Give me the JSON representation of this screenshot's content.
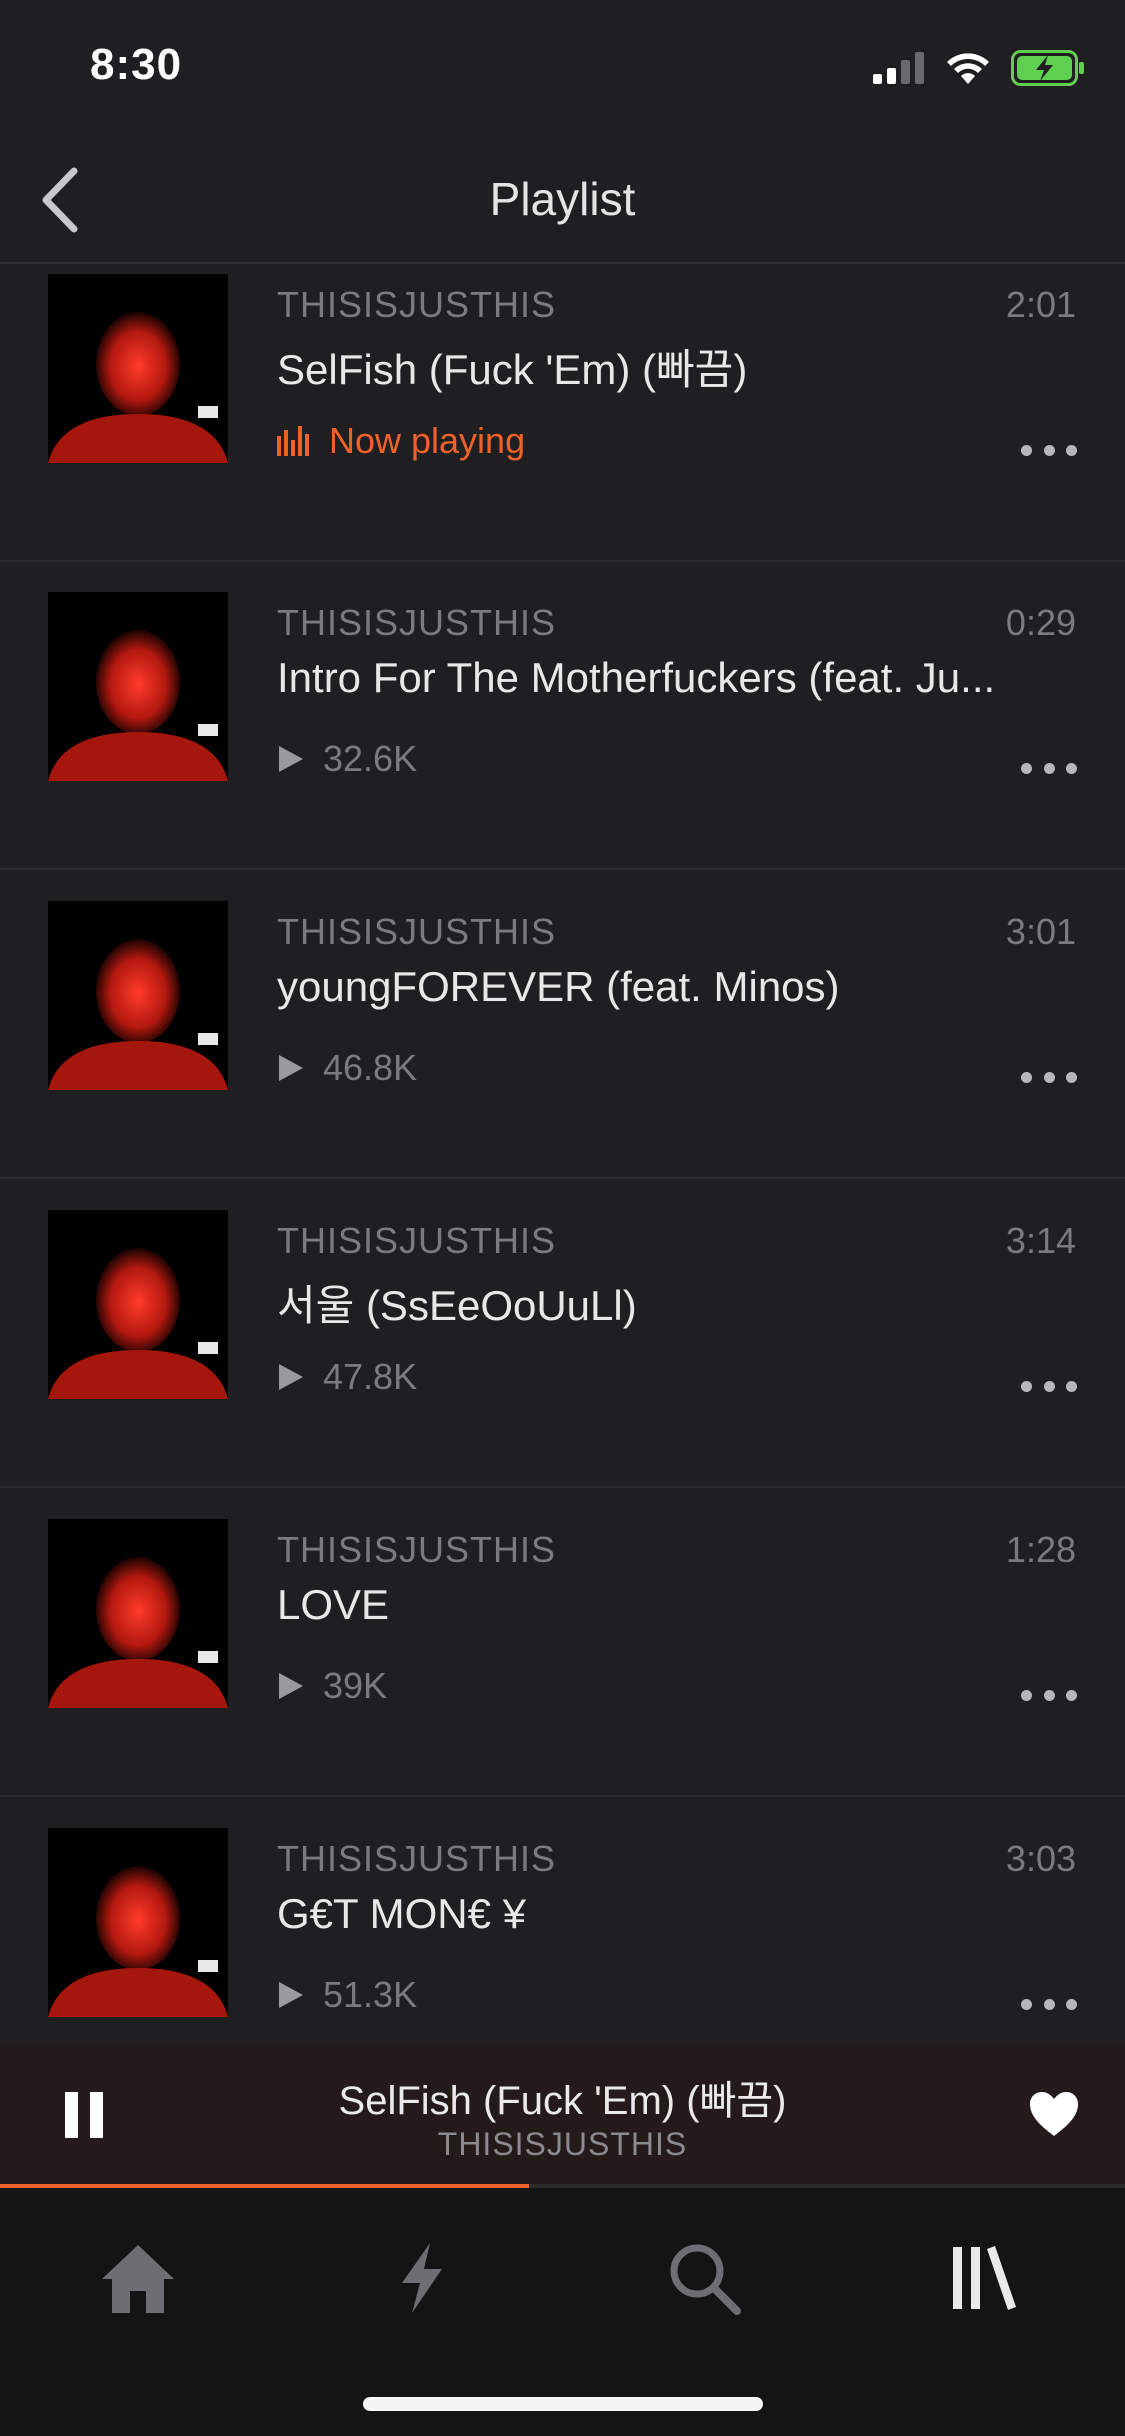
{
  "status_bar": {
    "time": "8:30",
    "signal_icon": "cellular-signal-icon",
    "wifi_icon": "wifi-icon",
    "battery_icon": "battery-charging-icon",
    "battery_color": "#5ecf4f"
  },
  "header": {
    "title": "Playlist",
    "back_icon": "chevron-left-icon"
  },
  "tracks": [
    {
      "artist": "THISISJUSTHIS",
      "duration": "2:01",
      "title": "SelFish (Fuck 'Em) (빠끔)",
      "status": "Now playing",
      "now_playing": true
    },
    {
      "artist": "THISISJUSTHIS",
      "duration": "0:29",
      "title": "Intro For The Motherfuckers (feat. Ju...",
      "plays": "32.6K"
    },
    {
      "artist": "THISISJUSTHIS",
      "duration": "3:01",
      "title": "youngFOREVER (feat. Minos)",
      "plays": "46.8K"
    },
    {
      "artist": "THISISJUSTHIS",
      "duration": "3:14",
      "title": "서울 (SsEeOoUuLl)",
      "plays": "47.8K"
    },
    {
      "artist": "THISISJUSTHIS",
      "duration": "1:28",
      "title": "LOVE",
      "plays": "39K"
    },
    {
      "artist": "THISISJUSTHIS",
      "duration": "3:03",
      "title": "G€T MON€ ¥",
      "plays": "51.3K"
    }
  ],
  "mini_player": {
    "title": "SelFish (Fuck 'Em) (빠끔)",
    "artist": "THISISJUSTHIS",
    "progress": 0.47,
    "pause_icon": "pause-icon",
    "like_icon": "heart-icon"
  },
  "tab_bar": {
    "tabs": [
      {
        "name": "home",
        "icon": "home-icon"
      },
      {
        "name": "stream",
        "icon": "lightning-icon"
      },
      {
        "name": "search",
        "icon": "search-icon"
      },
      {
        "name": "library",
        "icon": "library-icon"
      }
    ],
    "active_index": 3
  },
  "colors": {
    "accent": "#f0612a",
    "background": "#1f1f21",
    "mini_player_bg": "#231a19",
    "tab_bar_bg": "#141415"
  }
}
